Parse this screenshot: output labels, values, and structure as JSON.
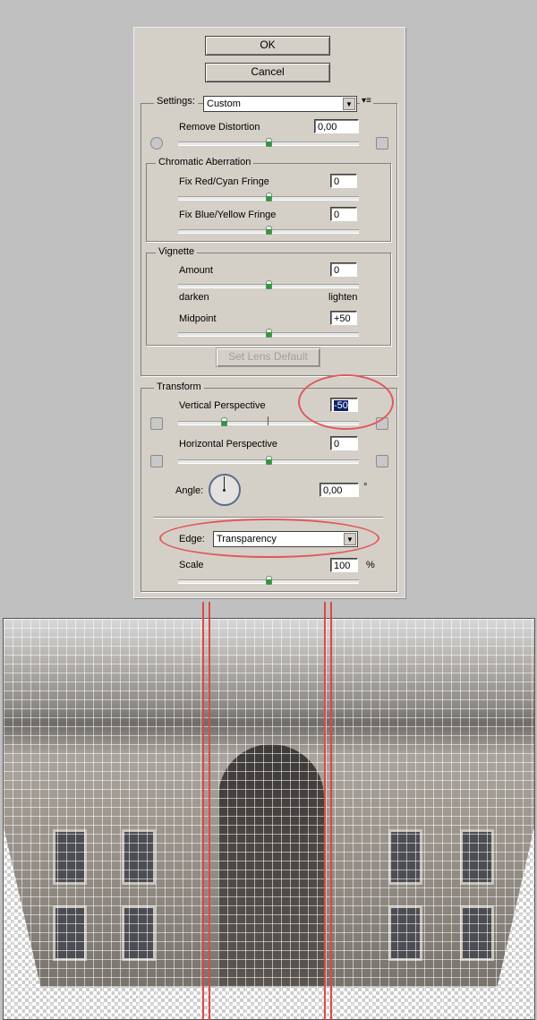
{
  "dialog": {
    "ok_label": "OK",
    "cancel_label": "Cancel",
    "settings": {
      "label": "Settings:",
      "value": "Custom",
      "menu_icon": "flyout-menu-icon"
    },
    "remove_distortion": {
      "label": "Remove Distortion",
      "value": "0,00",
      "slider_fraction": 0.5
    },
    "chromatic": {
      "title": "Chromatic Aberration",
      "red_cyan": {
        "label": "Fix Red/Cyan Fringe",
        "value": "0",
        "slider_fraction": 0.5
      },
      "blue_yellow": {
        "label": "Fix Blue/Yellow Fringe",
        "value": "0",
        "slider_fraction": 0.5
      }
    },
    "vignette": {
      "title": "Vignette",
      "amount": {
        "label": "Amount",
        "value": "0",
        "slider_fraction": 0.5
      },
      "darken": "darken",
      "lighten": "lighten",
      "midpoint": {
        "label": "Midpoint",
        "value": "+50",
        "slider_fraction": 0.5
      }
    },
    "set_lens_default": "Set Lens Default",
    "transform": {
      "title": "Transform",
      "vertical": {
        "label": "Vertical Perspective",
        "value": "-50",
        "slider_fraction": 0.25
      },
      "horizontal": {
        "label": "Horizontal Perspective",
        "value": "0",
        "slider_fraction": 0.5
      },
      "angle": {
        "label": "Angle:",
        "value": "0,00",
        "unit": "°"
      },
      "edge": {
        "label": "Edge:",
        "value": "Transparency"
      },
      "scale": {
        "label": "Scale",
        "value": "100",
        "unit": "%",
        "slider_fraction": 0.5
      }
    }
  },
  "annotation_color": "#e05a5a"
}
